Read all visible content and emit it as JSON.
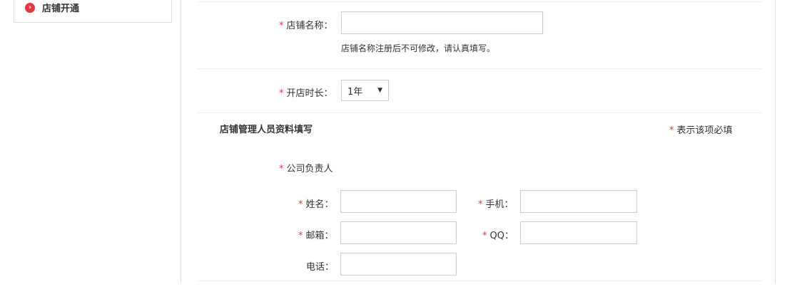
{
  "sidebar": {
    "items": [
      {
        "label": "店铺开通",
        "icon": "chevron-right-circle-icon"
      }
    ]
  },
  "form": {
    "shop_name": {
      "label": "店铺名称：",
      "value": "",
      "placeholder": "",
      "hint": "店铺名称注册后不可修改，请认真填写。"
    },
    "open_duration": {
      "label": "开店时长：",
      "selected": "1年"
    }
  },
  "manager_section": {
    "title": "店铺管理人员资料填写",
    "required_legend": "表示该项必填",
    "company_head_label": "公司负责人",
    "fields": {
      "name": {
        "label": "姓名：",
        "value": ""
      },
      "mobile": {
        "label": "手机：",
        "value": ""
      },
      "email": {
        "label": "邮箱：",
        "value": ""
      },
      "qq": {
        "label": "QQ：",
        "value": ""
      },
      "phone": {
        "label": "电话：",
        "value": ""
      }
    }
  },
  "required_mark": "*",
  "colors": {
    "required": "#e0393e",
    "border": "#cccccc",
    "text": "#333333"
  }
}
